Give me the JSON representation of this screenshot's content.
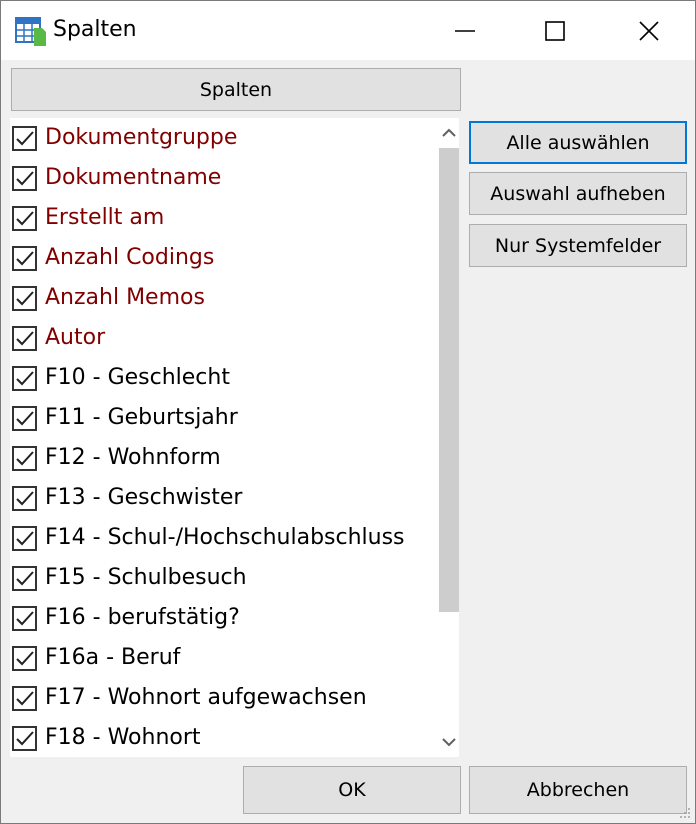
{
  "window": {
    "title": "Spalten",
    "icon": "table-icon",
    "controls": [
      "minimize-icon",
      "maximize-icon",
      "close-icon"
    ]
  },
  "header_button": {
    "label": "Spalten"
  },
  "columns": [
    {
      "label": "Dokumentgruppe",
      "checked": true,
      "type": "system"
    },
    {
      "label": "Dokumentname",
      "checked": true,
      "type": "system"
    },
    {
      "label": "Erstellt am",
      "checked": true,
      "type": "system"
    },
    {
      "label": "Anzahl Codings",
      "checked": true,
      "type": "system"
    },
    {
      "label": "Anzahl Memos",
      "checked": true,
      "type": "system"
    },
    {
      "label": "Autor",
      "checked": true,
      "type": "system"
    },
    {
      "label": "F10 - Geschlecht",
      "checked": true,
      "type": "user"
    },
    {
      "label": "F11 - Geburtsjahr",
      "checked": true,
      "type": "user"
    },
    {
      "label": "F12 - Wohnform",
      "checked": true,
      "type": "user"
    },
    {
      "label": "F13 - Geschwister",
      "checked": true,
      "type": "user"
    },
    {
      "label": "F14 - Schul-/Hochschulabschluss",
      "checked": true,
      "type": "user"
    },
    {
      "label": "F15 - Schulbesuch",
      "checked": true,
      "type": "user"
    },
    {
      "label": "F16 - berufstätig?",
      "checked": true,
      "type": "user"
    },
    {
      "label": "F16a - Beruf",
      "checked": true,
      "type": "user"
    },
    {
      "label": "F17 - Wohnort aufgewachsen",
      "checked": true,
      "type": "user"
    },
    {
      "label": "F18 - Wohnort",
      "checked": true,
      "type": "user"
    }
  ],
  "side_buttons": {
    "select_all": "Alle auswählen",
    "deselect": "Auswahl aufheben",
    "system_only": "Nur Systemfelder"
  },
  "footer": {
    "ok": "OK",
    "cancel": "Abbrechen"
  },
  "colors": {
    "system_field": "#800000",
    "user_field": "#000000",
    "focus_border": "#0078d7"
  }
}
